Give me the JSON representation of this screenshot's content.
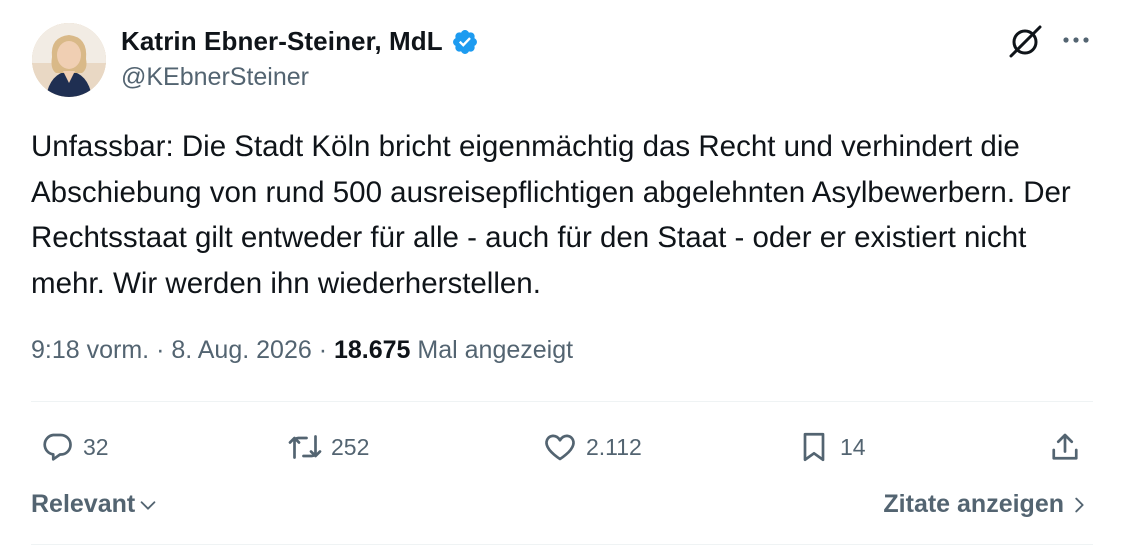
{
  "author": {
    "name": "Katrin Ebner-Steiner, MdL",
    "handle": "@KEbnerSteiner",
    "verified": true,
    "verified_color": "#1d9bf0"
  },
  "tweet": {
    "text": "Unfassbar: Die Stadt Köln bricht eigenmächtig das Recht und verhindert die Abschiebung von rund 500 ausreisepflichtigen abgelehnten Asylbewerbern. Der Rechtsstaat gilt entweder für alle - auch für den Staat - oder er existiert nicht mehr. Wir werden ihn wiederherstellen.",
    "time": "9:18 vorm.",
    "separator": "·",
    "date": "8. Aug. 2026",
    "views_count": "18.675",
    "views_label": "Mal angezeigt"
  },
  "actions": {
    "replies": "32",
    "reposts": "252",
    "likes": "2.112",
    "bookmarks": "14"
  },
  "footer": {
    "sort_label": "Relevant",
    "quotes_label": "Zitate anzeigen"
  },
  "icons": [
    "grok-icon",
    "more-icon",
    "reply-icon",
    "repost-icon",
    "like-icon",
    "bookmark-icon",
    "share-icon",
    "chevron-down-icon",
    "chevron-right-icon",
    "verified-badge-icon"
  ],
  "colors": {
    "text": "#0f1419",
    "muted": "#536471",
    "divider": "#eff3f4"
  }
}
